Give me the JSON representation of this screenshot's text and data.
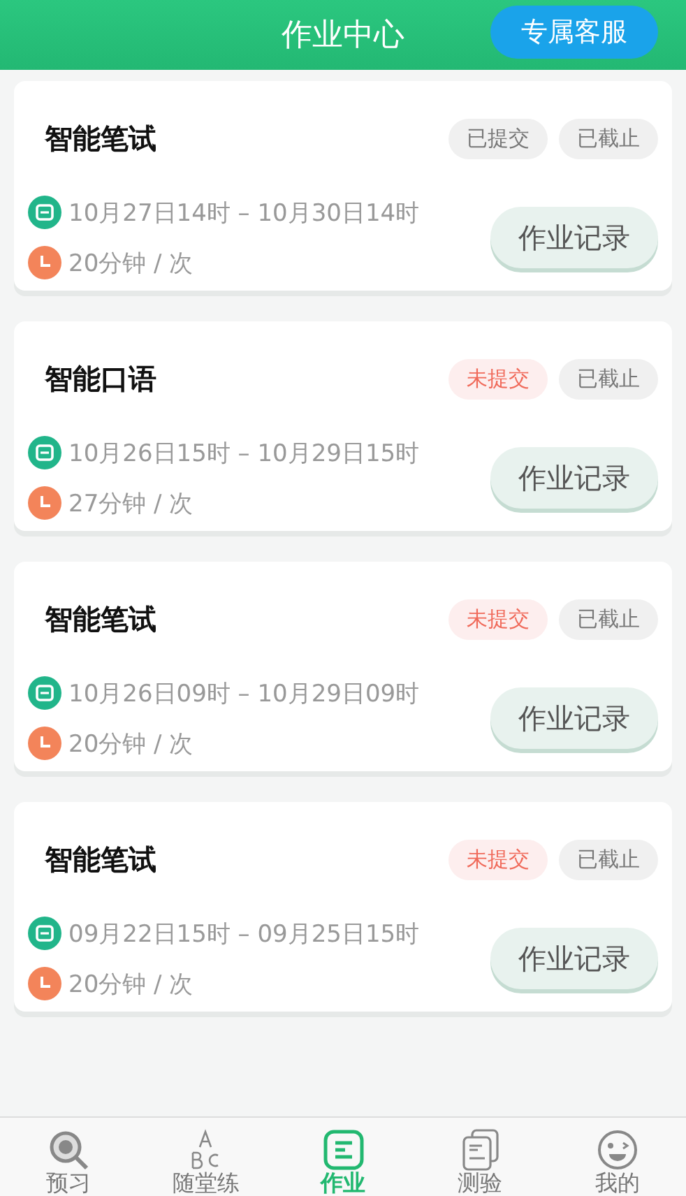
{
  "header": {
    "title": "作业中心",
    "service_button": "专属客服"
  },
  "assignments": [
    {
      "title": "智能笔试",
      "status": "已提交",
      "submitted": true,
      "deadline": "已截止",
      "time_range": "10月27日14时 – 10月30日14时",
      "duration": "20分钟 / 次",
      "record_button": "作业记录"
    },
    {
      "title": "智能口语",
      "status": "未提交",
      "submitted": false,
      "deadline": "已截止",
      "time_range": "10月26日15时 – 10月29日15时",
      "duration": "27分钟 / 次",
      "record_button": "作业记录"
    },
    {
      "title": "智能笔试",
      "status": "未提交",
      "submitted": false,
      "deadline": "已截止",
      "time_range": "10月26日09时 – 10月29日09时",
      "duration": "20分钟 / 次",
      "record_button": "作业记录"
    },
    {
      "title": "智能笔试",
      "status": "未提交",
      "submitted": false,
      "deadline": "已截止",
      "time_range": "09月22日15时 – 09月25日15时",
      "duration": "20分钟 / 次",
      "record_button": "作业记录"
    }
  ],
  "tab_bar": [
    {
      "kind": "preview",
      "label": "预习",
      "selected": false
    },
    {
      "kind": "practice",
      "label": "随堂练",
      "selected": false
    },
    {
      "kind": "homework",
      "label": "作业",
      "selected": true
    },
    {
      "kind": "test",
      "label": "测验",
      "selected": false
    },
    {
      "kind": "me",
      "label": "我的",
      "selected": false
    }
  ]
}
